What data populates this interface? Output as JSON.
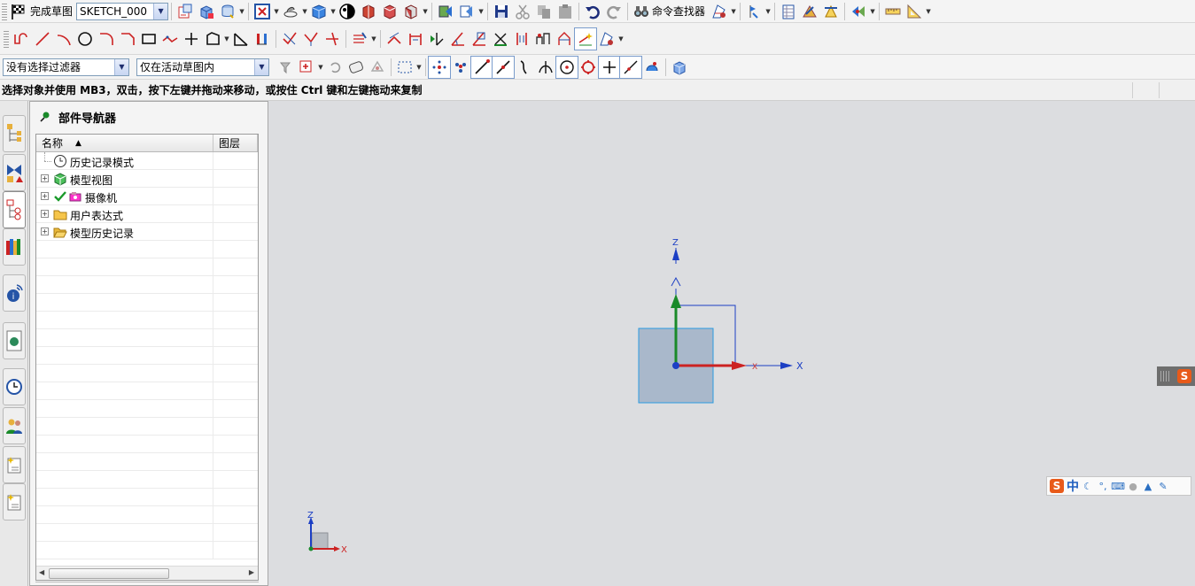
{
  "toolbar1": {
    "finish_sketch_label": "完成草图",
    "sketch_name": "SKETCH_000",
    "command_finder_label": "命令查找器"
  },
  "selection_bar": {
    "filter_value": "没有选择过滤器",
    "scope_value": "仅在活动草图内"
  },
  "cue_line": {
    "text": "选择对象并使用 MB3，双击，按下左键并拖动来移动，或按住 Ctrl 键和左键拖动来复制"
  },
  "part_navigator": {
    "title": "部件导航器",
    "columns": [
      "名称",
      "图层"
    ],
    "items": [
      {
        "label": "历史记录模式",
        "expandable": false,
        "icon": "clock-icon"
      },
      {
        "label": "模型视图",
        "expandable": true,
        "icon": "model-views-icon"
      },
      {
        "label": "摄像机",
        "expandable": true,
        "icon": "camera-icon",
        "checked": true
      },
      {
        "label": "用户表达式",
        "expandable": true,
        "icon": "folder-icon"
      },
      {
        "label": "模型历史记录",
        "expandable": true,
        "icon": "folder-open-icon"
      }
    ]
  },
  "graphics": {
    "axis_labels": {
      "x": "X",
      "y_small": "X",
      "z": "Z"
    },
    "triad_labels": {
      "x": "X",
      "z": "Z"
    }
  },
  "ime": {
    "logo": "S",
    "mode": "中"
  },
  "colors": {
    "x_axis": "#cc2222",
    "z_axis": "#1a8a2a",
    "datum_blue": "#1c3fc4",
    "plane_fill": "#a8b8cc",
    "background": "#dcdde0"
  }
}
